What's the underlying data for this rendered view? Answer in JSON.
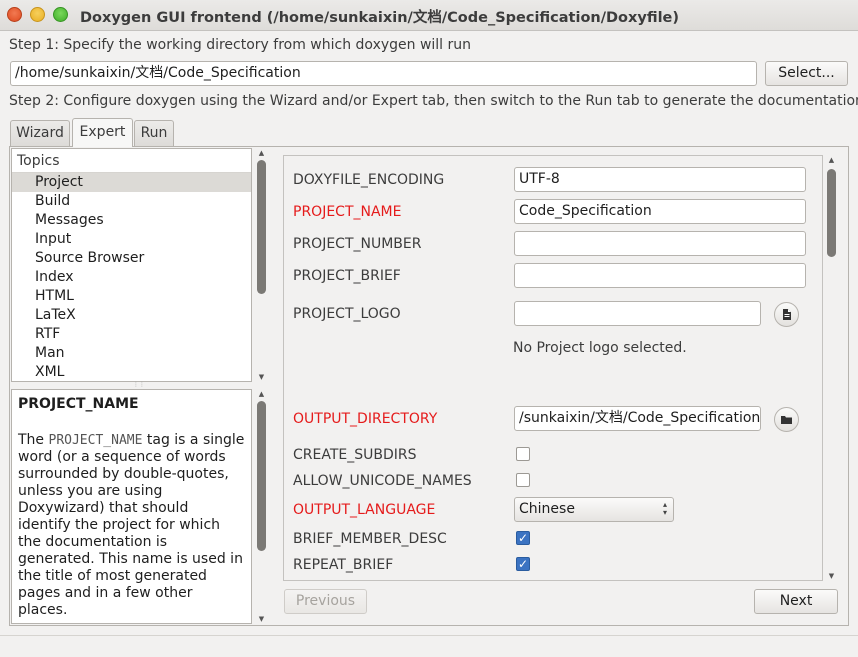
{
  "window": {
    "title": "Doxygen GUI frontend (/home/sunkaixin/文档/Code_Specification/Doxyfile)"
  },
  "step1": {
    "label": "Step 1: Specify the working directory from which doxygen will run",
    "directory_value": "/home/sunkaixin/文档/Code_Specification",
    "select_label": "Select..."
  },
  "step2": {
    "label": "Step 2: Configure doxygen using the Wizard and/or Expert tab, then switch to the Run tab to generate the documentation"
  },
  "tabs": [
    {
      "label": "Wizard",
      "active": false
    },
    {
      "label": "Expert",
      "active": true
    },
    {
      "label": "Run",
      "active": false
    }
  ],
  "topics": {
    "header": "Topics",
    "items": [
      "Project",
      "Build",
      "Messages",
      "Input",
      "Source Browser",
      "Index",
      "HTML",
      "LaTeX",
      "RTF",
      "Man",
      "XML"
    ],
    "selected": "Project"
  },
  "help": {
    "title": "PROJECT_NAME",
    "text_prefix": "The ",
    "tag": "PROJECT_NAME",
    "text_rest": " tag is a single word (or a sequence of words surrounded by double-quotes, unless you are using Doxywizard) that should identify the project for which the documentation is generated. This name is used in the title of most generated pages and in a few other places."
  },
  "settings": {
    "doxyfile_encoding": {
      "label": "DOXYFILE_ENCODING",
      "value": "UTF-8"
    },
    "project_name": {
      "label": "PROJECT_NAME",
      "value": "Code_Specification"
    },
    "project_number": {
      "label": "PROJECT_NUMBER",
      "value": ""
    },
    "project_brief": {
      "label": "PROJECT_BRIEF",
      "value": ""
    },
    "project_logo": {
      "label": "PROJECT_LOGO",
      "value": "",
      "note": "No Project logo selected."
    },
    "output_directory": {
      "label": "OUTPUT_DIRECTORY",
      "value": "/sunkaixin/文档/Code_Specification"
    },
    "create_subdirs": {
      "label": "CREATE_SUBDIRS",
      "checked": false
    },
    "allow_unicode_names": {
      "label": "ALLOW_UNICODE_NAMES",
      "checked": false
    },
    "output_language": {
      "label": "OUTPUT_LANGUAGE",
      "value": "Chinese"
    },
    "brief_member_desc": {
      "label": "BRIEF_MEMBER_DESC",
      "checked": true
    },
    "repeat_brief": {
      "label": "REPEAT_BRIEF",
      "checked": true
    }
  },
  "nav": {
    "previous_label": "Previous",
    "next_label": "Next"
  },
  "icons": {
    "file_open": "file-icon",
    "folder_open": "folder-icon"
  },
  "colors": {
    "modified_label": "#e51b1b",
    "checkbox_checked": "#3b73c2"
  }
}
